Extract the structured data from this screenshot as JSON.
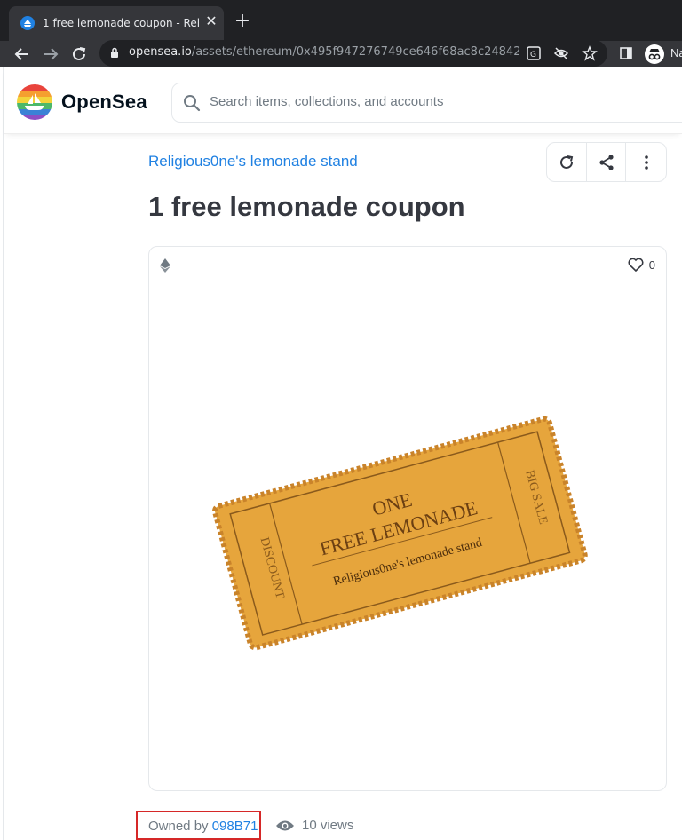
{
  "browser": {
    "tab_title": "1 free lemonade coupon - Religio",
    "url_host": "opensea.io",
    "url_path": "/assets/ethereum/0x495f947276749ce646f68ac8c2484200...",
    "profile_label": "Na"
  },
  "header": {
    "brand": "OpenSea",
    "search_placeholder": "Search items, collections, and accounts"
  },
  "asset": {
    "collection": "Religious0ne's lemonade stand",
    "title": "1 free lemonade coupon",
    "favorites": "0",
    "ticket": {
      "line1": "ONE",
      "line2": "FREE LEMONADE",
      "line3": "Religious0ne's lemonade stand",
      "left_stub": "DISCOUNT",
      "right_stub": "BIG SALE"
    },
    "owned_by_label": "Owned by",
    "owner": "098B71",
    "views": "10 views"
  },
  "colors": {
    "accent": "#2081e2",
    "title": "#353840",
    "muted": "#707a83",
    "highlight_box": "#d62828",
    "ticket": "#e6a53c"
  }
}
